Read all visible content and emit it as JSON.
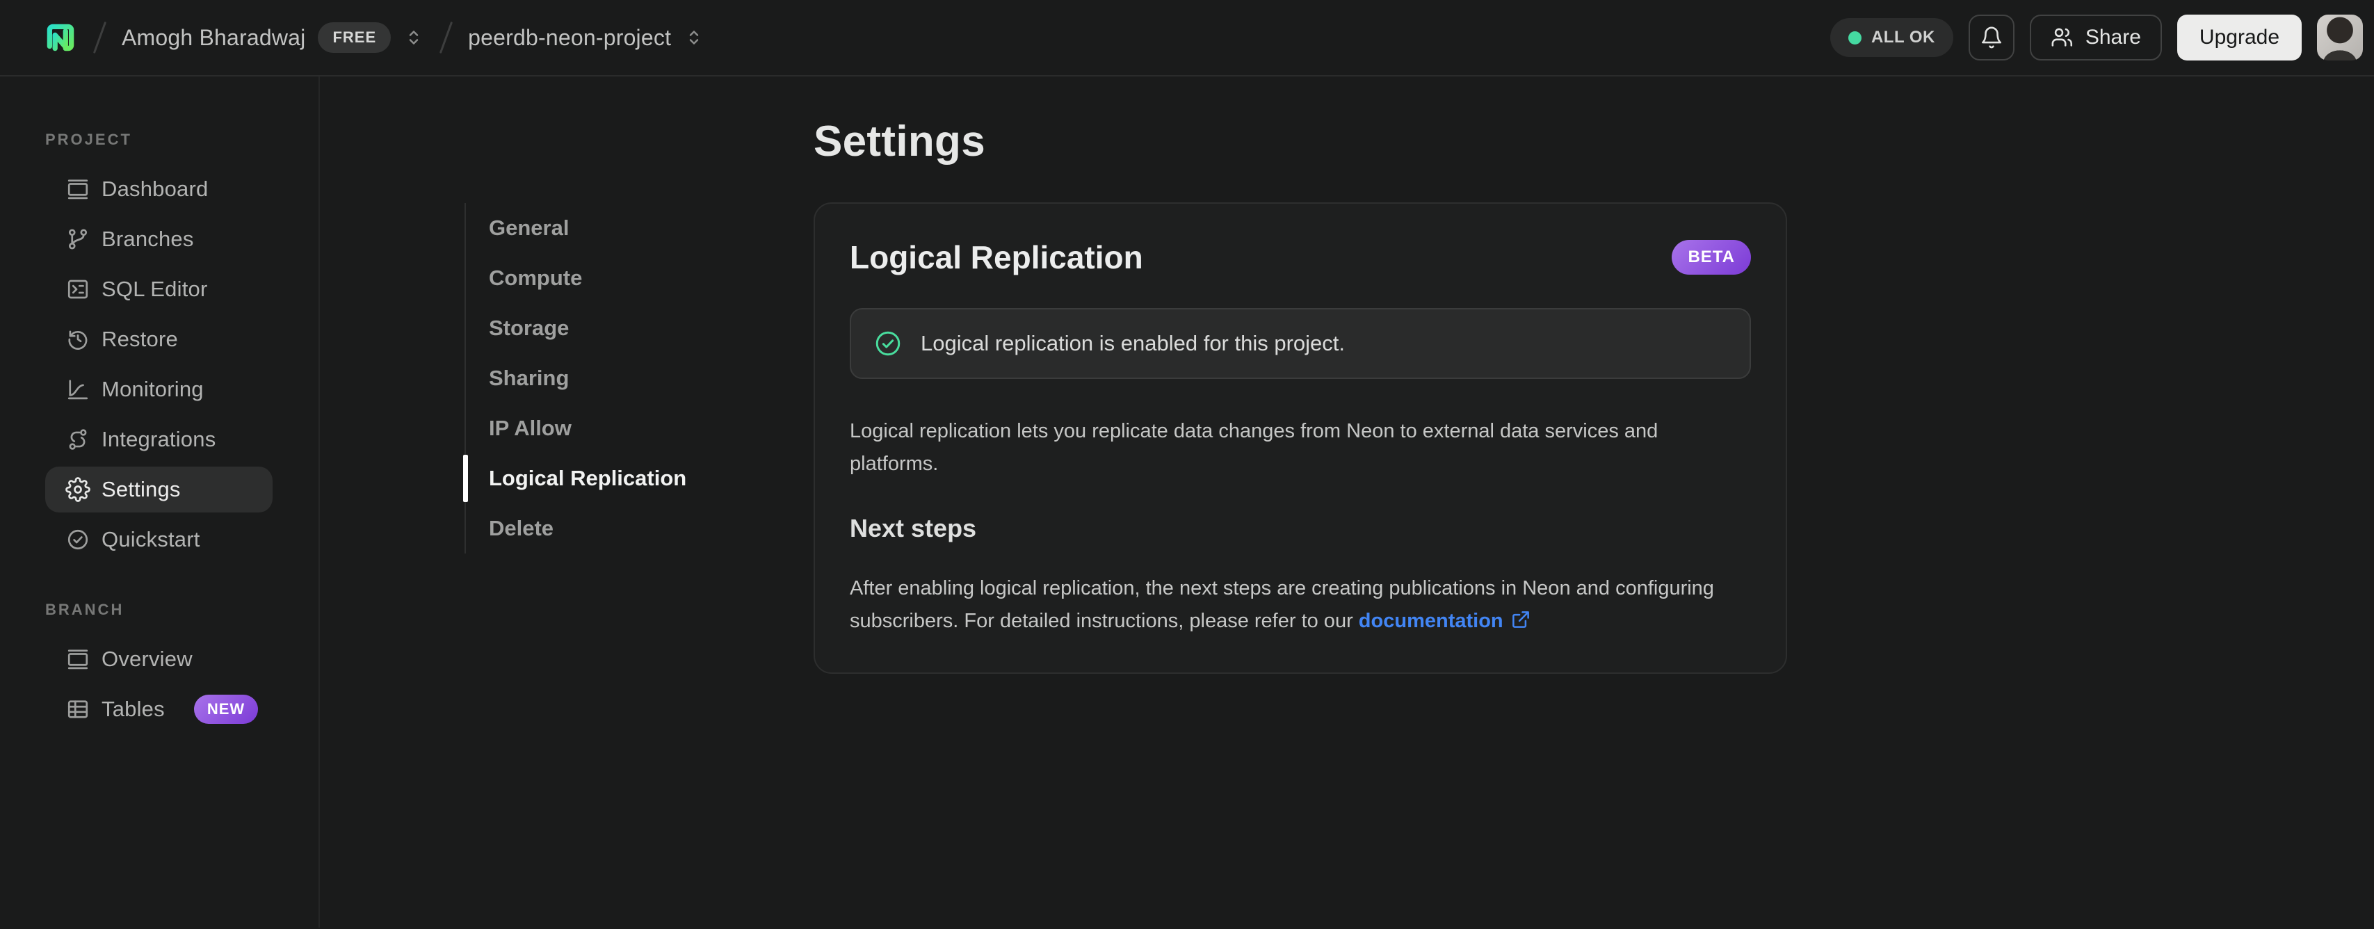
{
  "header": {
    "breadcrumb": {
      "org_name": "Amogh Bharadwaj",
      "org_plan_badge": "FREE",
      "project_name": "peerdb-neon-project"
    },
    "status_pill_label": "ALL OK",
    "share_button_label": "Share",
    "upgrade_button_label": "Upgrade"
  },
  "sidebar": {
    "project_section_label": "PROJECT",
    "project_items": [
      {
        "label": "Dashboard",
        "icon": "dashboard-icon"
      },
      {
        "label": "Branches",
        "icon": "branches-icon"
      },
      {
        "label": "SQL Editor",
        "icon": "sql-editor-icon"
      },
      {
        "label": "Restore",
        "icon": "restore-icon"
      },
      {
        "label": "Monitoring",
        "icon": "monitoring-icon"
      },
      {
        "label": "Integrations",
        "icon": "integrations-icon"
      },
      {
        "label": "Settings",
        "icon": "settings-icon",
        "active": true
      },
      {
        "label": "Quickstart",
        "icon": "quickstart-icon"
      }
    ],
    "branch_section_label": "BRANCH",
    "branch_items": [
      {
        "label": "Overview",
        "icon": "overview-icon"
      },
      {
        "label": "Tables",
        "icon": "tables-icon",
        "badge": "NEW"
      }
    ]
  },
  "settings_nav": {
    "items": [
      {
        "label": "General"
      },
      {
        "label": "Compute"
      },
      {
        "label": "Storage"
      },
      {
        "label": "Sharing"
      },
      {
        "label": "IP Allow"
      },
      {
        "label": "Logical Replication",
        "active": true
      },
      {
        "label": "Delete"
      }
    ]
  },
  "main": {
    "page_title": "Settings",
    "card": {
      "title": "Logical Replication",
      "beta_badge": "BETA",
      "alert_text": "Logical replication is enabled for this project.",
      "description": "Logical replication lets you replicate data changes from Neon to external data services and platforms.",
      "next_steps_heading": "Next steps",
      "next_steps_text": "After enabling logical replication, the next steps are creating publications in Neon and configuring subscribers. For detailed instructions, please refer to our ",
      "doc_link_label": "documentation"
    }
  },
  "colors": {
    "brand_green": "#00e599",
    "status_green": "#45d9a1",
    "badge_purple_start": "#a873ea",
    "badge_purple_end": "#7c3bd6",
    "link_blue": "#4285f4",
    "background": "#1a1b1b",
    "card_background": "#1e1f1f"
  }
}
